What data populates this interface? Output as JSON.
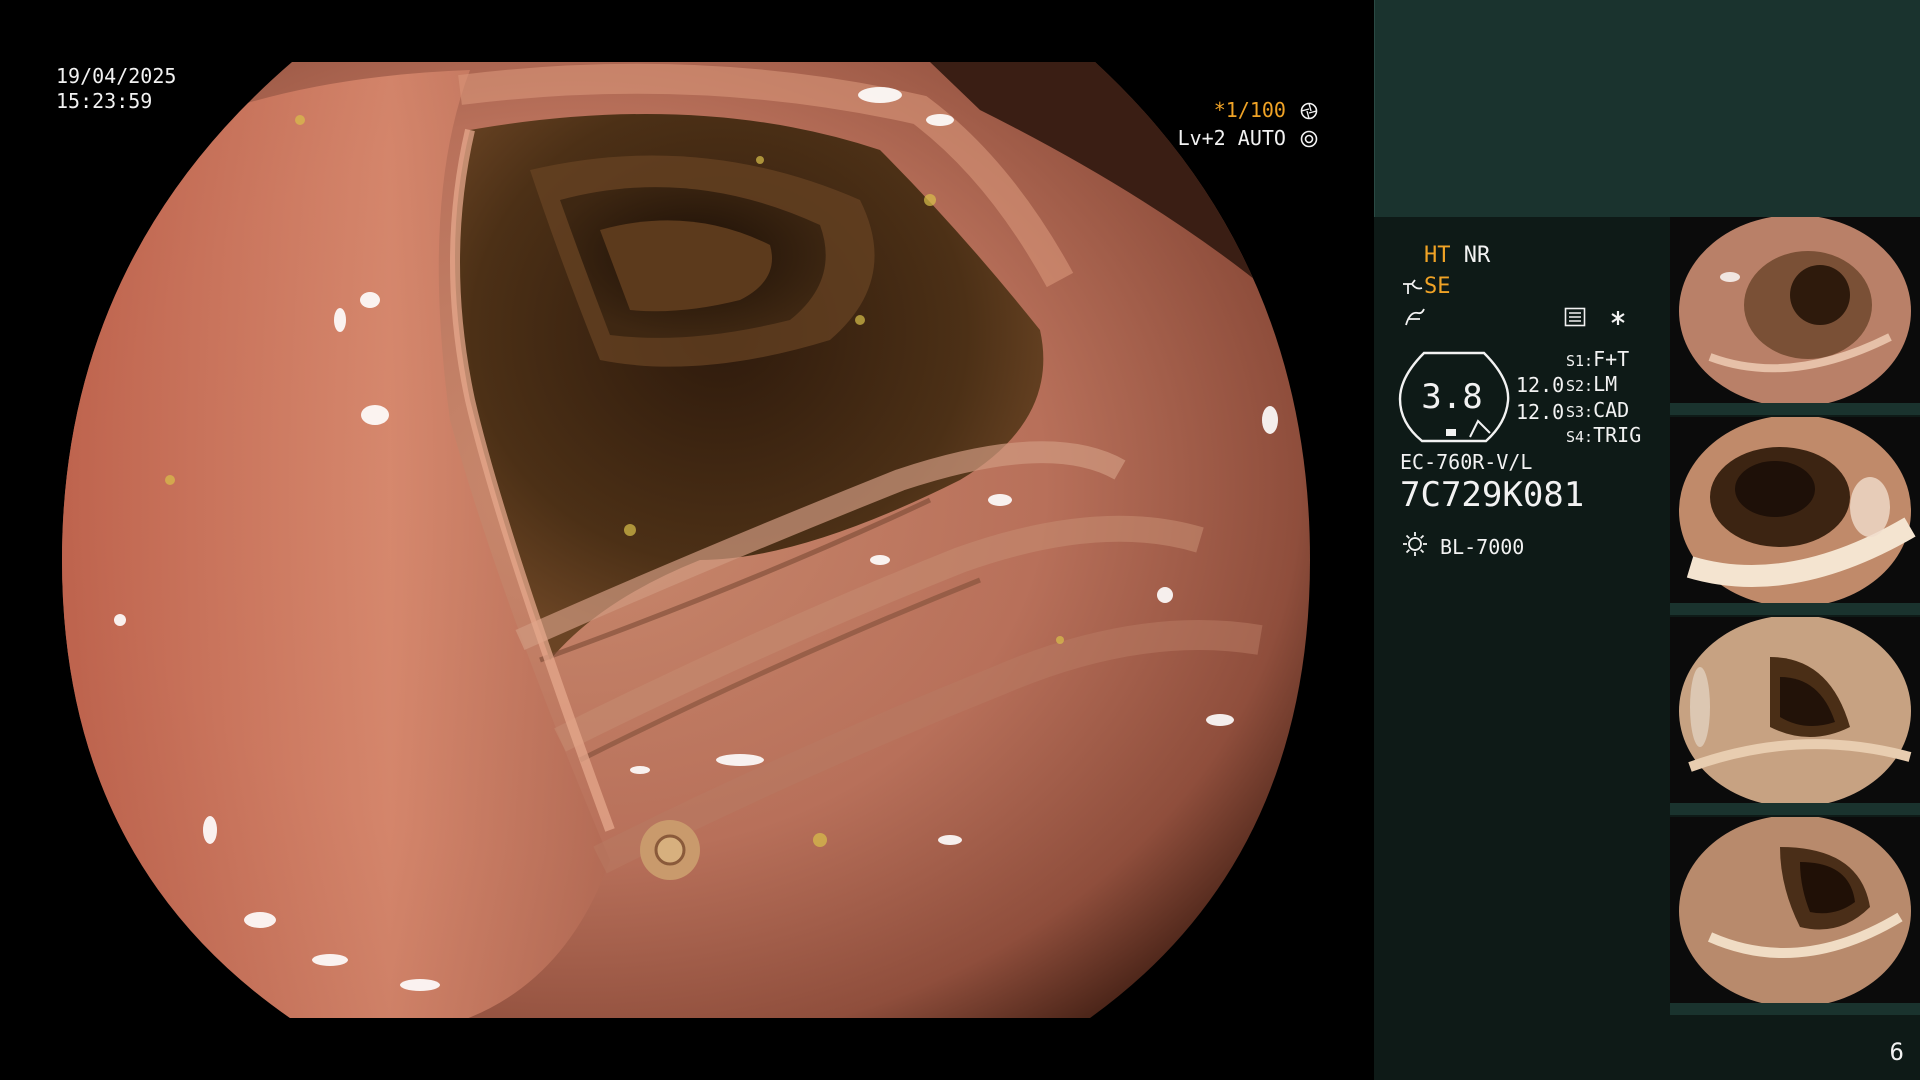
{
  "overlay": {
    "date": "19/04/2025",
    "time": "15:23:59",
    "shutter": "*1/100",
    "shutter_icon": "shutter-icon",
    "level": "Lv+2",
    "mode": "AUTO",
    "mode_icon": "iris-auto-icon"
  },
  "settings": {
    "ht": "HT",
    "nr": "NR",
    "se": "SE",
    "se_icon": "structure-enhance-icon",
    "enhance_icon": "enhance-curve-icon",
    "tools_icons": [
      "settings-box-icon",
      "asterisk-icon"
    ],
    "aperture": "3.8",
    "gain_1": "12.0",
    "gain_2": "12.0",
    "switches": [
      {
        "key": "S1:",
        "value": "F+T"
      },
      {
        "key": "S2:",
        "value": "LM"
      },
      {
        "key": "S3:",
        "value": "CAD"
      },
      {
        "key": "S4:",
        "value": "TRIG"
      }
    ],
    "scope_model": "EC-760R-V/L",
    "scope_serial": "7C729K081",
    "light_icon": "light-source-icon",
    "light_source": "BL-7000"
  },
  "thumbnails": [
    {
      "index": 1
    },
    {
      "index": 2
    },
    {
      "index": 3
    },
    {
      "index": 4
    }
  ],
  "page_number": "6",
  "colors": {
    "amber": "#f0a326",
    "panel_top": "#1a332e",
    "panel": "#0e1a17",
    "mucosa": "#b8705a",
    "lumen": "#3a2412"
  }
}
